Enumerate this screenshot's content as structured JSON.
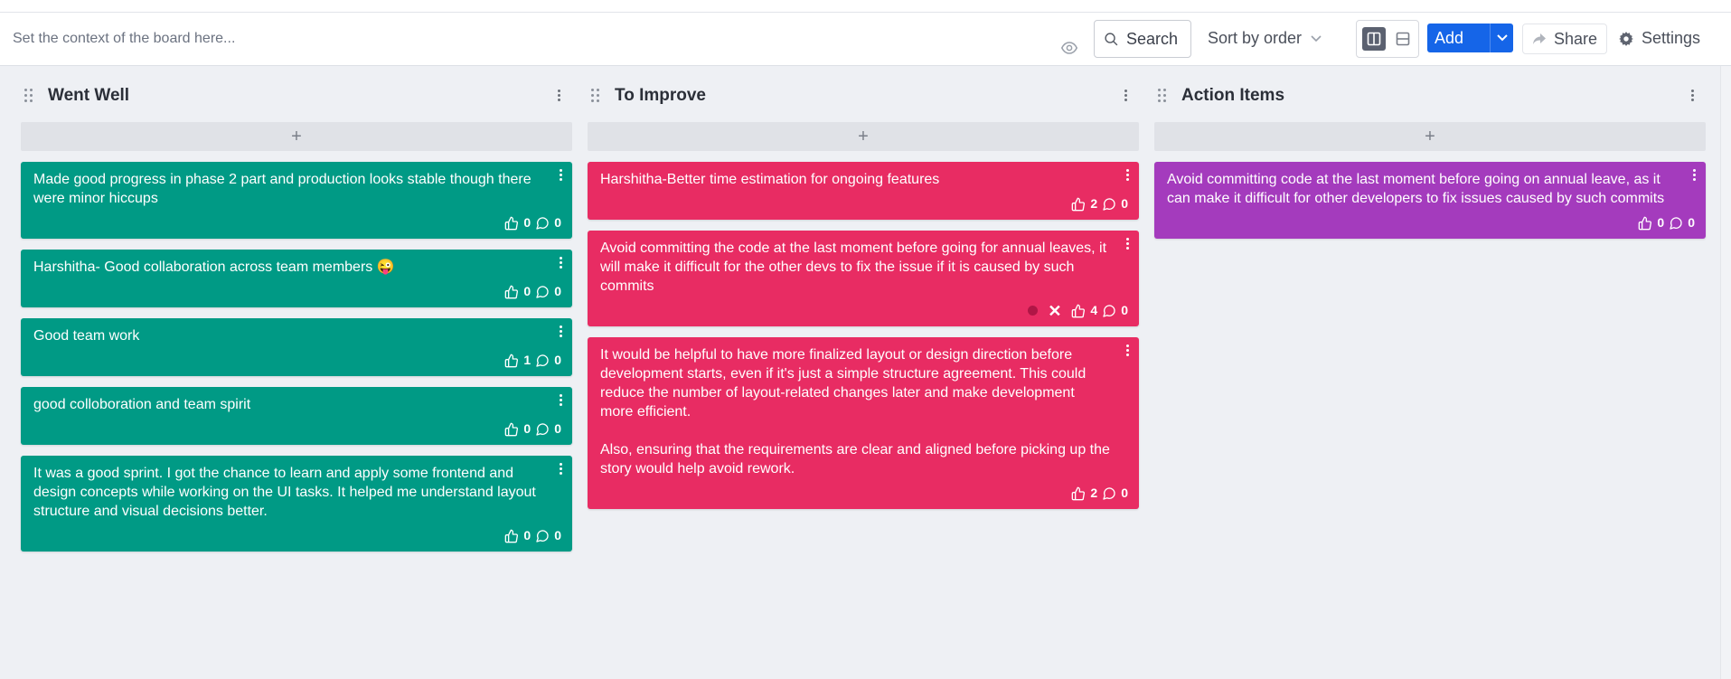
{
  "toolbar": {
    "context_placeholder": "Set the context of the board here...",
    "search_label": "Search",
    "sort_label": "Sort by order",
    "add_label": "Add",
    "share_label": "Share",
    "settings_label": "Settings"
  },
  "colors": {
    "went_well": "#009a85",
    "to_improve": "#e82c63",
    "action_items": "#a43bbd",
    "primary": "#1565e8"
  },
  "columns": [
    {
      "title": "Went Well",
      "add_symbol": "+",
      "cards": [
        {
          "text": "Made good progress in phase 2 part and production looks stable though there were minor hiccups",
          "likes": "0",
          "comments": "0"
        },
        {
          "text": "Harshitha- Good collaboration across team members 😜",
          "likes": "0",
          "comments": "0"
        },
        {
          "text": "Good team work",
          "likes": "1",
          "comments": "0"
        },
        {
          "text": "good colloboration and team spirit",
          "likes": "0",
          "comments": "0"
        },
        {
          "text": "It was a good sprint. I got the chance to learn and apply some frontend and design concepts while working on the UI tasks. It helped me understand layout structure and visual decisions better.",
          "likes": "0",
          "comments": "0"
        }
      ]
    },
    {
      "title": "To Improve",
      "add_symbol": "+",
      "cards": [
        {
          "text": "Harshitha-Better time estimation for ongoing features",
          "likes": "2",
          "comments": "0"
        },
        {
          "text": "Avoid committing the code at the last moment before going for annual leaves, it will make it difficult for the other devs to fix the issue if it is caused by such commits",
          "likes": "4",
          "comments": "0"
        },
        {
          "text": "It would be helpful to have more finalized layout or design direction before development starts, even if it's just a simple structure agreement. This could reduce the number of layout-related changes later and make development more efficient.\n\nAlso, ensuring that the requirements are clear and aligned before picking up the story would help avoid rework.",
          "likes": "2",
          "comments": "0"
        }
      ]
    },
    {
      "title": "Action Items",
      "add_symbol": "+",
      "cards": [
        {
          "text": "Avoid committing code at the last moment before going on annual leave, as it can make it difficult for other developers to fix issues caused by such commits",
          "likes": "0",
          "comments": "0"
        }
      ]
    }
  ]
}
